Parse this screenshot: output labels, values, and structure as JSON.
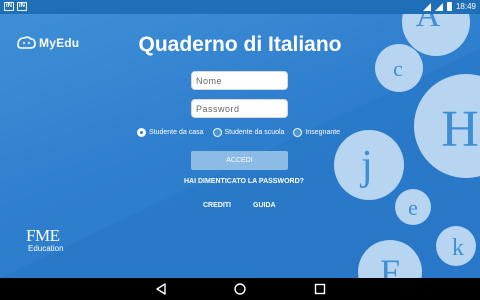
{
  "status_bar": {
    "left_icons": [
      "IN",
      "IN"
    ],
    "time": "18:49"
  },
  "app": {
    "logo_text": "MyEdu",
    "title": "Quaderno di Italiano",
    "name_placeholder": "Nome",
    "password_placeholder": "Password",
    "roles": [
      {
        "label": "Studente da casa",
        "selected": true
      },
      {
        "label": "Studente da scuola",
        "selected": false
      },
      {
        "label": "Insegnante",
        "selected": false
      }
    ],
    "login_label": "ACCEDI",
    "forgot_password_label": "HAI DIMENTICATO LA PASSWORD?",
    "credits_label": "CREDITI",
    "guide_label": "GUIDA",
    "publisher_logo": {
      "line1": "FME",
      "line2": "Education"
    }
  },
  "decor_letters": [
    "A",
    "c",
    "H",
    "j",
    "e",
    "k",
    "F"
  ],
  "colors": {
    "status_bar": "#1f6fb8",
    "background": "#2f7fcf",
    "bubble": "#c6def4",
    "button": "#8cbbe6"
  },
  "nav_icons": [
    "back-icon",
    "home-icon",
    "recents-icon"
  ]
}
